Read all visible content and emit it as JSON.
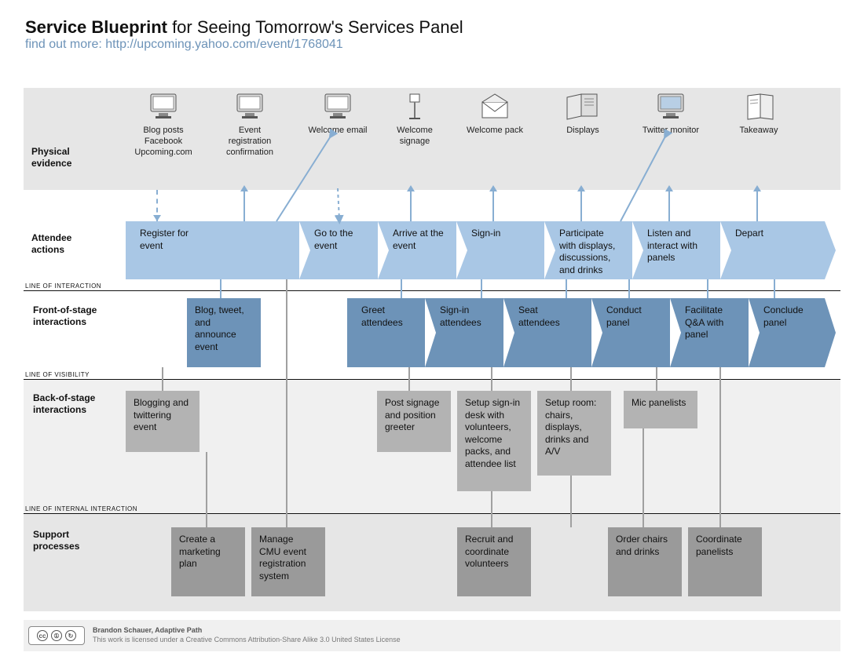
{
  "title_bold": "Service Blueprint",
  "title_rest": " for Seeing Tomorrow's Services Panel",
  "subtitle": "find out more: http://upcoming.yahoo.com/event/1768041",
  "row_labels": {
    "physical_evidence": "Physical\nevidence",
    "attendee_actions": "Attendee\nactions",
    "front_of_stage": "Front-of-stage\ninteractions",
    "back_of_stage": "Back-of-stage\ninteractions",
    "support_processes": "Support\nprocesses"
  },
  "line_labels": {
    "interaction": "LINE OF INTERACTION",
    "visibility": "LINE OF VISIBILITY",
    "internal": "LINE OF INTERNAL INTERACTION"
  },
  "physical_evidence": [
    {
      "label": "Blog posts\nFacebook\nUpcoming.com",
      "icon": "monitor"
    },
    {
      "label": "Event\nregistration\nconfirmation",
      "icon": "monitor"
    },
    {
      "label": "Welcome email",
      "icon": "monitor"
    },
    {
      "label": "Welcome\nsignage",
      "icon": "sign"
    },
    {
      "label": "Welcome pack",
      "icon": "envelope"
    },
    {
      "label": "Displays",
      "icon": "boards"
    },
    {
      "label": "Twitter monitor",
      "icon": "monitor"
    },
    {
      "label": "Takeaway",
      "icon": "booklet"
    }
  ],
  "attendee_actions": [
    "Register for\nevent",
    "Go to the event",
    "Arrive at the\nevent",
    "Sign-in",
    "Participate\nwith displays,\ndiscussions,\nand drinks",
    "Listen and\ninteract with\npanels",
    "Depart"
  ],
  "front_of_stage": {
    "box": "Blog, tweet,\nand announce\nevent",
    "steps": [
      "Greet\nattendees",
      "Sign-in\nattendees",
      "Seat\nattendees",
      "Conduct\npanel",
      "Facilitate\nQ&A with\npanel",
      "Conclude\npanel"
    ]
  },
  "back_of_stage": [
    "Blogging and\ntwittering\nevent",
    "Post signage\nand position\ngreeter",
    "Setup sign-in\ndesk with\nvolunteers,\nwelcome\npacks, and\nattendee list",
    "Setup room:\nchairs,\ndisplays,\ndrinks and\nA/V",
    "Mic panelists"
  ],
  "support_processes": [
    "Create a\nmarketing\nplan",
    "Manage\nCMU event\nregistration\nsystem",
    "Recruit and\ncoordinate\nvolunteers",
    "Order chairs\nand drinks",
    "Coordinate\npanelists"
  ],
  "footer": {
    "author": "Brandon Schauer, Adaptive Path",
    "license": "This work is licensed under a Creative Commons Attribution-Share Alike 3.0 United States License"
  }
}
